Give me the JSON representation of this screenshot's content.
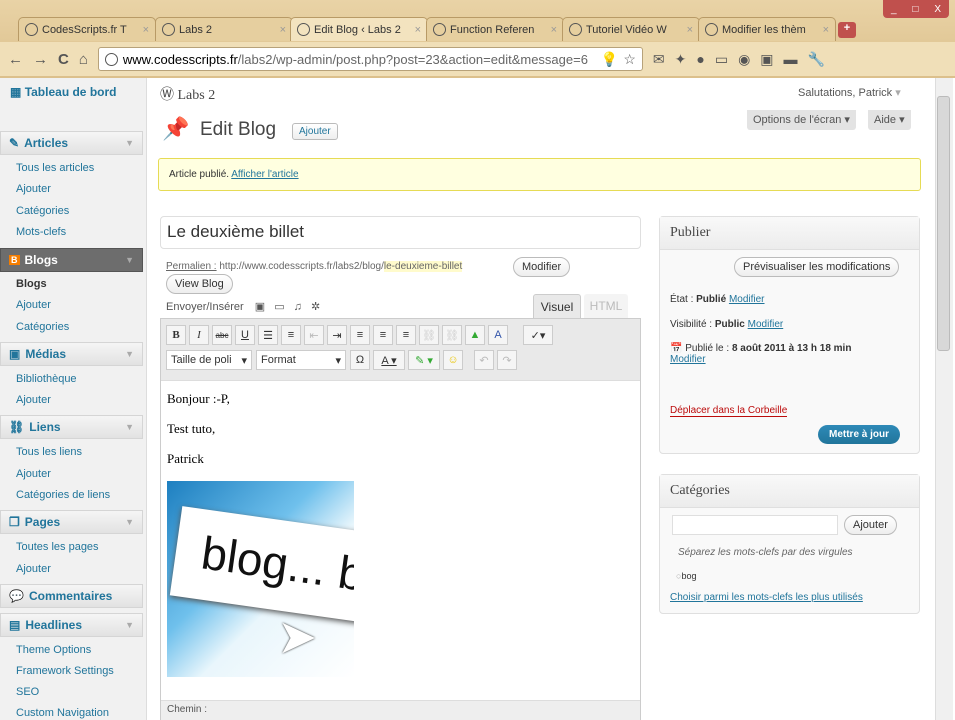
{
  "browser": {
    "tabs": [
      {
        "title": "CodesScripts.fr T"
      },
      {
        "title": "Labs 2"
      },
      {
        "title": "Edit Blog ‹ Labs 2"
      },
      {
        "title": "Function Referen"
      },
      {
        "title": "Tutoriel Vidéo W"
      },
      {
        "title": "Modifier les thèm"
      }
    ],
    "url_host": "www.codesscripts.fr",
    "url_path": "/labs2/wp-admin/post.php?post=23&action=edit&message=6",
    "window_controls": [
      "_",
      "□",
      "X"
    ]
  },
  "sidebar": {
    "dashboard": "Tableau de bord",
    "sections": [
      {
        "label": "Articles",
        "items": [
          "Tous les articles",
          "Ajouter",
          "Catégories",
          "Mots-clefs"
        ]
      },
      {
        "label": "Blogs",
        "items": [
          "Blogs",
          "Ajouter",
          "Catégories"
        ]
      },
      {
        "label": "Médias",
        "items": [
          "Bibliothèque",
          "Ajouter"
        ]
      },
      {
        "label": "Liens",
        "items": [
          "Tous les liens",
          "Ajouter",
          "Catégories de liens"
        ]
      },
      {
        "label": "Pages",
        "items": [
          "Toutes les pages",
          "Ajouter"
        ]
      },
      {
        "label": "Commentaires",
        "items": []
      },
      {
        "label": "Headlines",
        "items": [
          "Theme Options",
          "Framework Settings",
          "SEO",
          "Custom Navigation"
        ]
      }
    ]
  },
  "header": {
    "site_name": "Labs 2",
    "greeting": "Salutations, Patrick",
    "page_title": "Edit Blog",
    "add_button": "Ajouter",
    "screen_options": "Options de l'écran",
    "help": "Aide"
  },
  "notice": {
    "text": "Article publié.",
    "link": "Afficher l'article"
  },
  "editor": {
    "title_value": "Le deuxième billet",
    "permalink_label": "Permalien :",
    "permalink_base": "http://www.codesscripts.fr/labs2/blog/",
    "permalink_slug": "le-deuxieme-billet",
    "modify_button": "Modifier",
    "view_button": "View Blog",
    "upload_label": "Envoyer/Insérer",
    "tab_visual": "Visuel",
    "tab_html": "HTML",
    "font_size_select": "Taille de poli",
    "format_select": "Format",
    "content_lines": [
      "Bonjour :-P,",
      "Test tuto,",
      "Patrick"
    ],
    "image_text": "blog... blo",
    "path_label": "Chemin :"
  },
  "publish": {
    "title": "Publier",
    "preview_button": "Prévisualiser les modifications",
    "status_label": "État :",
    "status_value": "Publié",
    "visibility_label": "Visibilité :",
    "visibility_value": "Public",
    "modify_link": "Modifier",
    "published_label": "Publié le :",
    "published_value": "8 août 2011 à 13 h 18 min",
    "trash_link": "Déplacer dans la Corbeille",
    "update_button": "Mettre à jour"
  },
  "categories": {
    "title": "Catégories",
    "add_button": "Ajouter",
    "hint": "Séparez les mots-clefs par des virgules",
    "tag": "bog",
    "choose_link": "Choisir parmi les mots-clefs les plus utilisés"
  },
  "colors": {
    "link": "#21759b",
    "primary_button": "#21759b",
    "notice_bg": "#ffffe0",
    "trash": "#bc0b0b"
  }
}
